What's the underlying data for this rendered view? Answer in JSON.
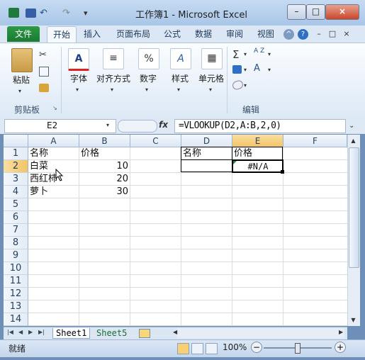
{
  "window": {
    "title": "工作簿1 - Microsoft Excel",
    "minimize": "–",
    "maximize": "□",
    "close": "×"
  },
  "quick_access": {
    "undo": "↶",
    "redo": "↷",
    "customize": "▾"
  },
  "tabs": [
    {
      "label": "文件"
    },
    {
      "label": "开始"
    },
    {
      "label": "插入"
    },
    {
      "label": "页面布局"
    },
    {
      "label": "公式"
    },
    {
      "label": "数据"
    },
    {
      "label": "审阅"
    },
    {
      "label": "视图"
    }
  ],
  "tab_icons": {
    "help": "?"
  },
  "ribbon": {
    "paste_label": "粘贴",
    "clipboard_group": "剪贴板",
    "font_label": "字体",
    "align_label": "对齐方式",
    "number_label": "数字",
    "style_label": "样式",
    "cells_label": "单元格",
    "edit_group": "编辑",
    "font_icon": "A",
    "number_icon": "%",
    "style_icon": "A",
    "sum_icon": "Σ",
    "sort_icon": "A Z",
    "find_icon": "A"
  },
  "formula_bar": {
    "name_box": "E2",
    "fx": "fx",
    "formula": "=VLOOKUP(D2,A:B,2,0)"
  },
  "columns": [
    "A",
    "B",
    "C",
    "D",
    "E",
    "F"
  ],
  "rows": [
    "1",
    "2",
    "3",
    "4",
    "5",
    "6",
    "7",
    "8",
    "9",
    "10",
    "11",
    "12",
    "13",
    "14"
  ],
  "cells": {
    "A1": "名称",
    "B1": "价格",
    "A2": "白菜",
    "B2": "10",
    "A3": "西红柿",
    "B3": "20",
    "A4": "萝卜",
    "B4": "30",
    "D1": "名称",
    "E1": "价格",
    "E2": "#N/A"
  },
  "sheets": {
    "sheet1": "Sheet1",
    "sheet5": "Sheet5"
  },
  "status": {
    "ready": "就绪",
    "zoom": "100%",
    "zoom_out": "−",
    "zoom_in": "+"
  }
}
